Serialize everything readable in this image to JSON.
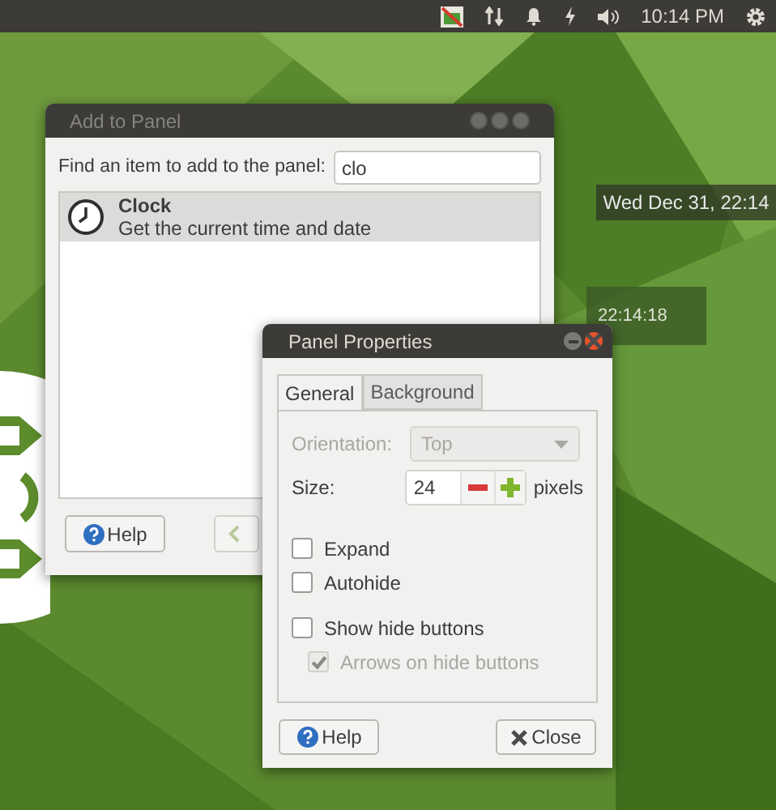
{
  "top_bar": {
    "time": "10:14 PM"
  },
  "desktop_clock": {
    "date": "Wed Dec 31, 22:14",
    "time": "22:14:18"
  },
  "add_to_panel": {
    "title": "Add to Panel",
    "search_label": "Find an item to add to the panel:",
    "search_value": "clo",
    "items": [
      {
        "name": "Clock",
        "description": "Get the current time and date",
        "selected": true
      }
    ],
    "help_button": "Help"
  },
  "panel_properties": {
    "title": "Panel Properties",
    "tabs": [
      {
        "label": "General",
        "selected": true
      },
      {
        "label": "Background",
        "selected": false
      }
    ],
    "orientation": {
      "label": "Orientation:",
      "value": "Top",
      "disabled": true
    },
    "size": {
      "label": "Size:",
      "value": "24",
      "unit": "pixels"
    },
    "option_groups": [
      [
        {
          "label": "Expand",
          "checked": false,
          "disabled": false
        },
        {
          "label": "Autohide",
          "checked": false,
          "disabled": false
        }
      ],
      [
        {
          "label": "Show hide buttons",
          "checked": false,
          "disabled": false,
          "children": [
            {
              "label": "Arrows on hide buttons",
              "checked": true,
              "disabled": true
            }
          ]
        }
      ]
    ],
    "buttons": [
      {
        "label": "Help",
        "kind": "help"
      },
      {
        "label": "Close",
        "kind": "close"
      }
    ]
  }
}
